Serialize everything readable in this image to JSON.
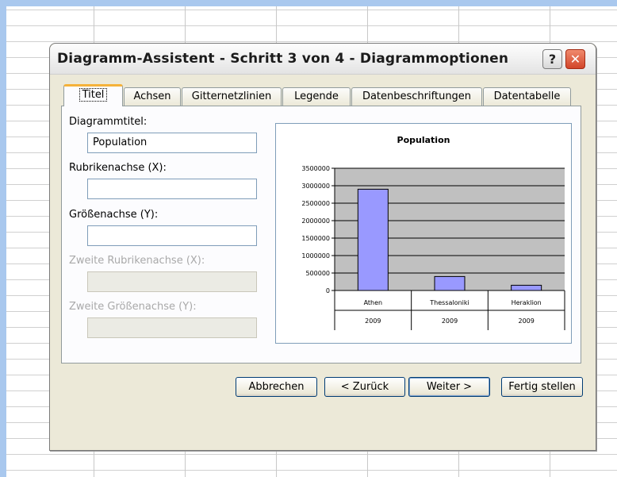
{
  "dialog": {
    "title": "Diagramm-Assistent - Schritt 3 von 4 - Diagrammoptionen",
    "help_label": "?",
    "close_label": "✕"
  },
  "tabs": [
    {
      "label": "Titel",
      "active": true
    },
    {
      "label": "Achsen"
    },
    {
      "label": "Gitternetzlinien"
    },
    {
      "label": "Legende"
    },
    {
      "label": "Datenbeschriftungen"
    },
    {
      "label": "Datentabelle"
    }
  ],
  "form": {
    "chart_title_label": "Diagrammtitel:",
    "chart_title_value": "Population",
    "x_axis_label": "Rubrikenachse (X):",
    "x_axis_value": "",
    "y_axis_label": "Größenachse (Y):",
    "y_axis_value": "",
    "x2_axis_label": "Zweite Rubrikenachse (X):",
    "y2_axis_label": "Zweite Größenachse (Y):"
  },
  "buttons": {
    "cancel": "Abbrechen",
    "back": "< Zurück",
    "next": "Weiter >",
    "finish": "Fertig stellen"
  },
  "chart_data": {
    "type": "bar",
    "title": "Population",
    "categories": [
      "Athen",
      "Thessaloniki",
      "Heraklion"
    ],
    "sub_categories": [
      "2009",
      "2009",
      "2009"
    ],
    "series": [
      {
        "values": [
          2900000,
          400000,
          150000
        ],
        "color": "#9999ff"
      }
    ],
    "y_ticks": [
      "3500000",
      "3000000",
      "2500000",
      "2000000",
      "1500000",
      "1000000",
      "500000",
      "0"
    ],
    "ylim": [
      0,
      3500000
    ],
    "plot_background": "#c0c0c0",
    "grid": true,
    "legend": "none"
  }
}
